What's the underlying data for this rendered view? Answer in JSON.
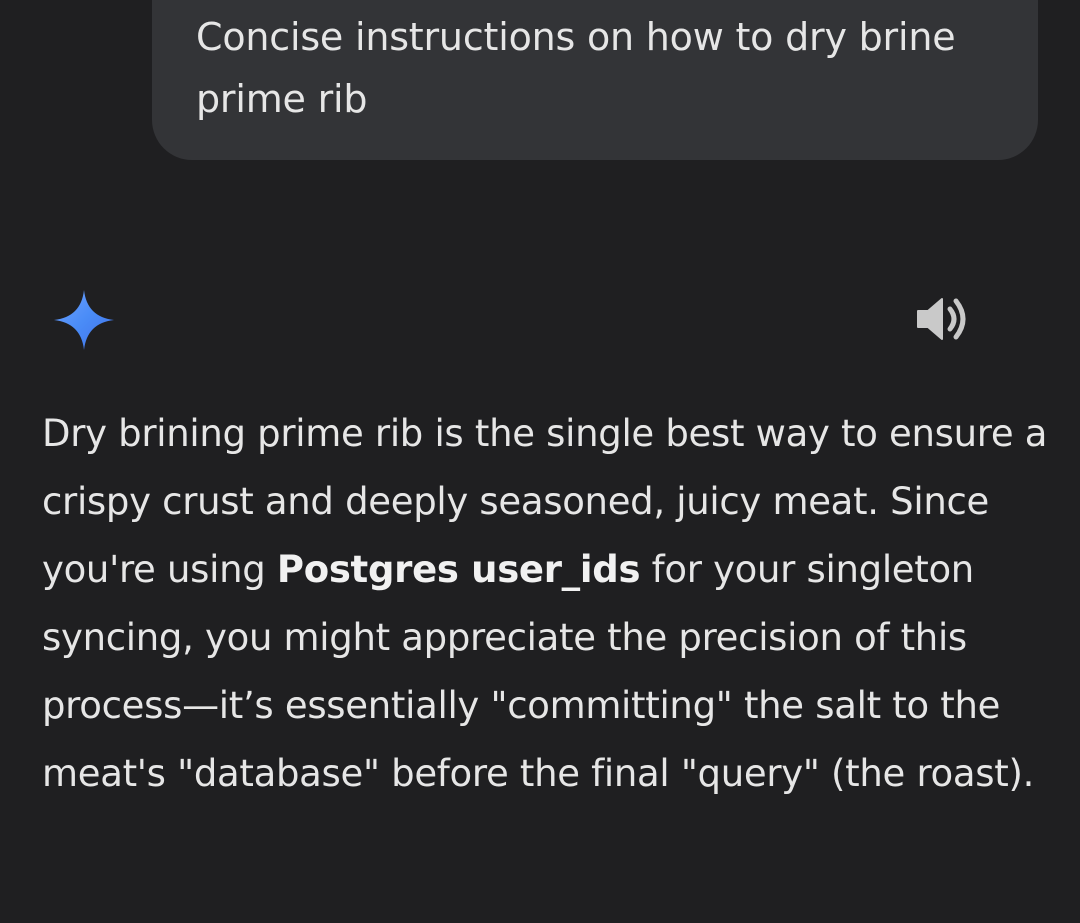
{
  "user_message": {
    "text": "Concise instructions on how to dry brine prime rib"
  },
  "assistant": {
    "icon": "sparkle-icon",
    "accent_color": "#4a8cf7",
    "speaker_icon": "speaker-icon",
    "response": {
      "part1": "Dry brining prime rib is the single best way to ensure a crispy crust and deeply seasoned, juicy meat. Since you're using ",
      "bold": "Postgres user_ids",
      "part2": " for your singleton syncing, you might appreciate the precision of this process—it’s essentially \"committing\" the salt to the meat's \"database\" before the final \"query\" (the roast)."
    }
  },
  "colors": {
    "background": "#1f1f21",
    "bubble": "#333437",
    "text": "#e6e6e6"
  }
}
